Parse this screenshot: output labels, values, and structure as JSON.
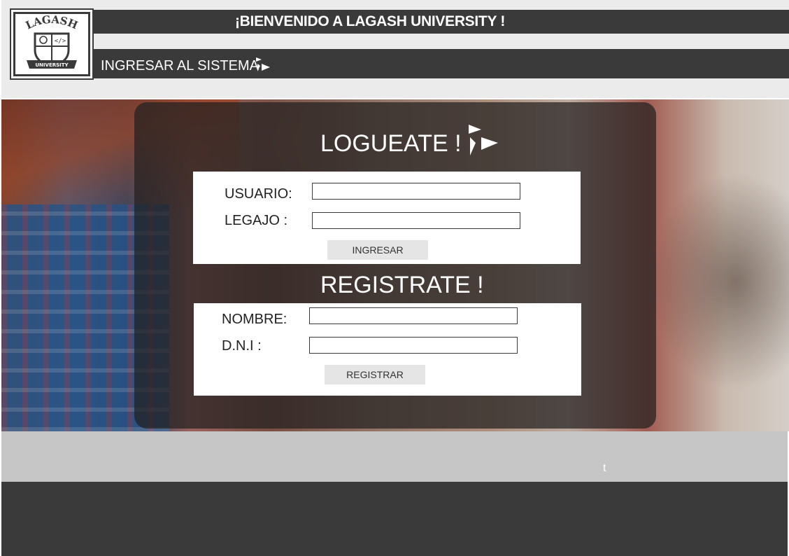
{
  "header": {
    "logo": {
      "top_text": "LAGASH",
      "banner_text": "UNIVERSITY"
    },
    "welcome_title": "¡BIENVENIDO A LAGASH UNIVERSITY !",
    "nav_link": "INGRESAR AL SISTEMA",
    "nav_icon": "play-arrow-icon"
  },
  "login": {
    "title": "LOGUEATE !",
    "title_icon": "play-arrow-icon",
    "usuario_label": "USUARIO:",
    "usuario_value": "",
    "legajo_label": "LEGAJO :",
    "legajo_value": "",
    "button": "INGRESAR"
  },
  "register": {
    "title": "REGISTRATE !",
    "nombre_label": "NOMBRE:",
    "nombre_value": "",
    "dni_label": "D.N.I :",
    "dni_value": "",
    "button": "REGISTRAR"
  },
  "band": {
    "text": "t"
  },
  "colors": {
    "dark": "#3b3a3b",
    "light_gray": "#ebebeb",
    "band_gray": "#c6c6c6",
    "button_gray": "#e5e5e5",
    "white": "#ffffff"
  }
}
